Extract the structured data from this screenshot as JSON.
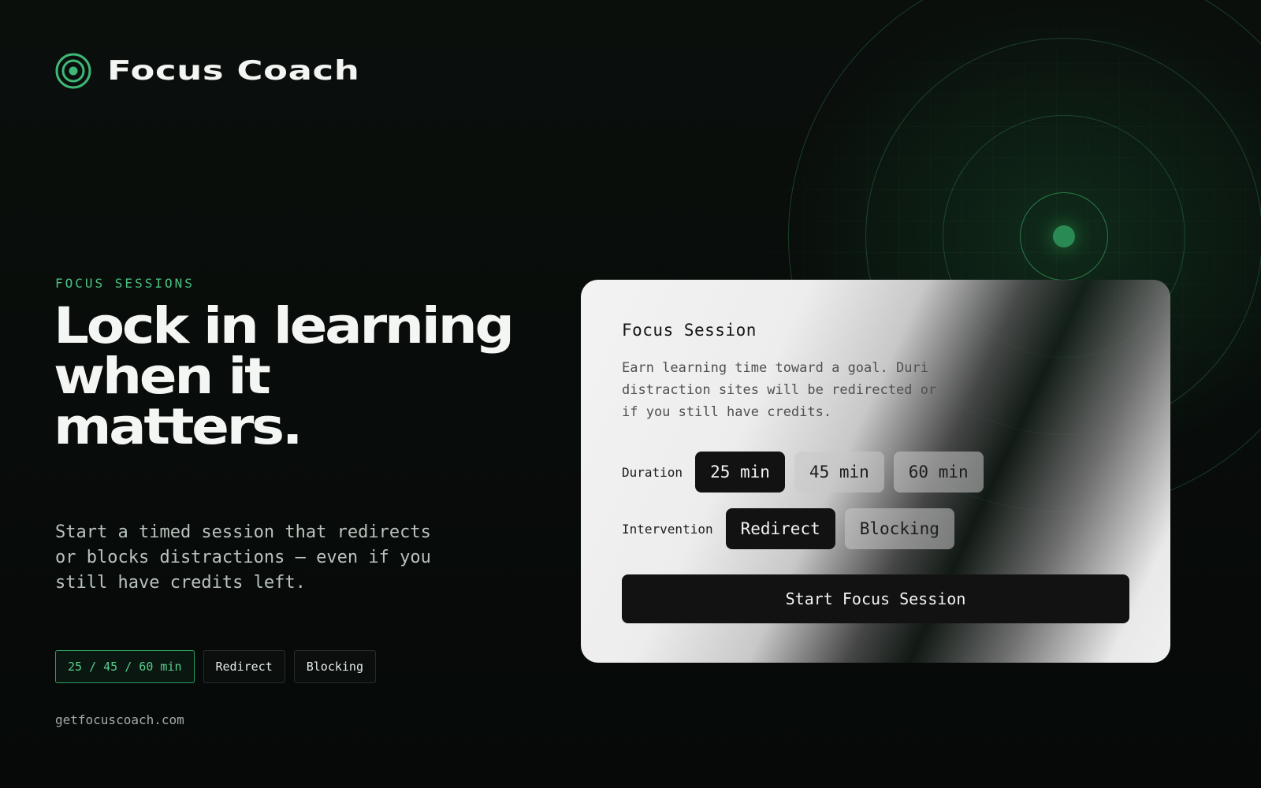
{
  "brand": {
    "name": "Focus Coach",
    "icon": "target-icon",
    "accent_color": "#3fb777"
  },
  "hero": {
    "eyebrow": "FOCUS SESSIONS",
    "headline": "Lock in learning when it matters.",
    "subtext": "Start a timed session that redirects or blocks distractions — even if you still have credits left.",
    "chips": [
      "25 / 45 / 60 min",
      "Redirect",
      "Blocking"
    ],
    "url": "getfocuscoach.com"
  },
  "card": {
    "title": "Focus Session",
    "description_line1": "Earn learning time toward a goal. Duri",
    "description_line2": "distraction sites will be redirected or",
    "description_line3": "if you still have credits.",
    "duration_label": "Duration",
    "duration_options": [
      "25 min",
      "45 min",
      "60 min"
    ],
    "duration_selected": "25 min",
    "intervention_label": "Intervention",
    "intervention_options": [
      "Redirect",
      "Blocking"
    ],
    "intervention_selected": "Redirect",
    "start_button": "Start Focus Session"
  },
  "decor": {
    "radar_icon": "target-rings",
    "radar_color": "#2a8a53"
  }
}
